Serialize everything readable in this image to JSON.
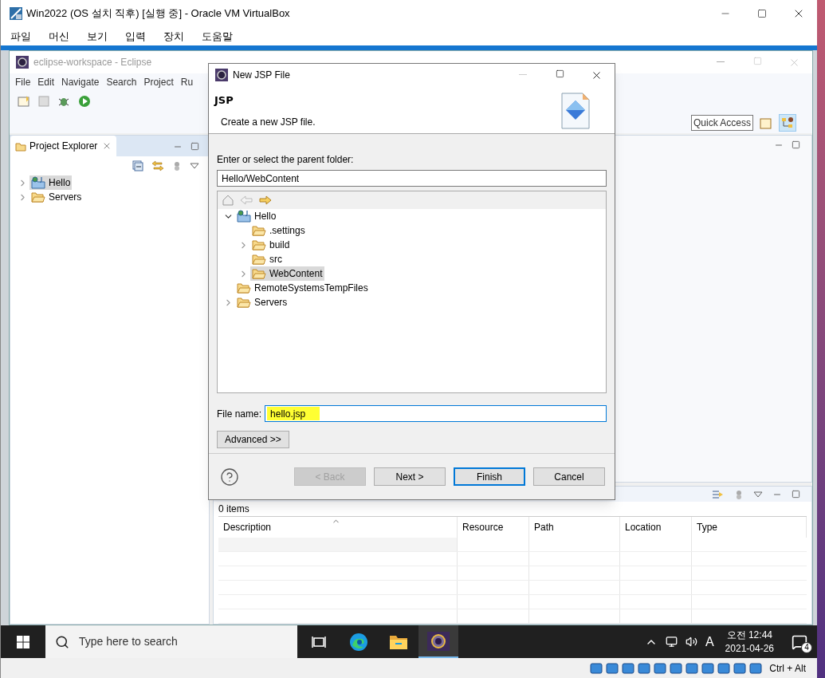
{
  "host_window": {
    "title": "Win2022 (OS 설치 직후) [실행 중] - Oracle VM VirtualBox",
    "menu": [
      "파일",
      "머신",
      "보기",
      "입력",
      "장치",
      "도움말"
    ]
  },
  "eclipse": {
    "title": "eclipse-workspace - Eclipse",
    "menu": [
      "File",
      "Edit",
      "Navigate",
      "Search",
      "Project",
      "Ru"
    ],
    "quick_access": "Quick Access",
    "project_explorer": {
      "tab": "Project Explorer",
      "items": [
        {
          "label": "Hello",
          "kind": "project",
          "expanded": false,
          "selected": true
        },
        {
          "label": "Servers",
          "kind": "folder",
          "expanded": false,
          "selected": false
        }
      ]
    },
    "markers": {
      "count": "0 items",
      "columns": [
        "Description",
        "Resource",
        "Path",
        "Location",
        "Type"
      ]
    }
  },
  "dialog": {
    "title": "New JSP File",
    "heading": "JSP",
    "description": "Create a new JSP file.",
    "folder_label": "Enter or select the parent folder:",
    "folder_value": "Hello/WebContent",
    "tree": [
      {
        "label": "Hello",
        "kind": "project",
        "expanded": true,
        "selected": false,
        "children": [
          {
            "label": ".settings",
            "kind": "folder",
            "selected": false
          },
          {
            "label": "build",
            "kind": "folder",
            "expanded": false,
            "selected": false
          },
          {
            "label": "src",
            "kind": "folder",
            "selected": false
          },
          {
            "label": "WebContent",
            "kind": "folder",
            "expanded": false,
            "selected": true
          }
        ]
      },
      {
        "label": "RemoteSystemsTempFiles",
        "kind": "folder",
        "selected": false
      },
      {
        "label": "Servers",
        "kind": "folder",
        "expanded": false,
        "selected": false
      }
    ],
    "file_label": "File name:",
    "file_value": "hello.jsp",
    "advanced": "Advanced >>",
    "buttons": [
      {
        "label": "< Back",
        "disabled": true,
        "default": false
      },
      {
        "label": "Next >",
        "disabled": false,
        "default": false
      },
      {
        "label": "Finish",
        "disabled": false,
        "default": true
      },
      {
        "label": "Cancel",
        "disabled": false,
        "default": false
      }
    ]
  },
  "taskbar": {
    "search_placeholder": "Type here to search",
    "apps": [
      {
        "kind": "taskview",
        "active": false
      },
      {
        "kind": "edge",
        "active": false
      },
      {
        "kind": "explorer",
        "active": false
      },
      {
        "kind": "eclipse",
        "active": true
      }
    ],
    "ime": "A",
    "time": "오전 12:44",
    "date": "2021-04-26",
    "notifications": "4"
  },
  "vbox_status": {
    "host_key": "Ctrl + Alt"
  }
}
